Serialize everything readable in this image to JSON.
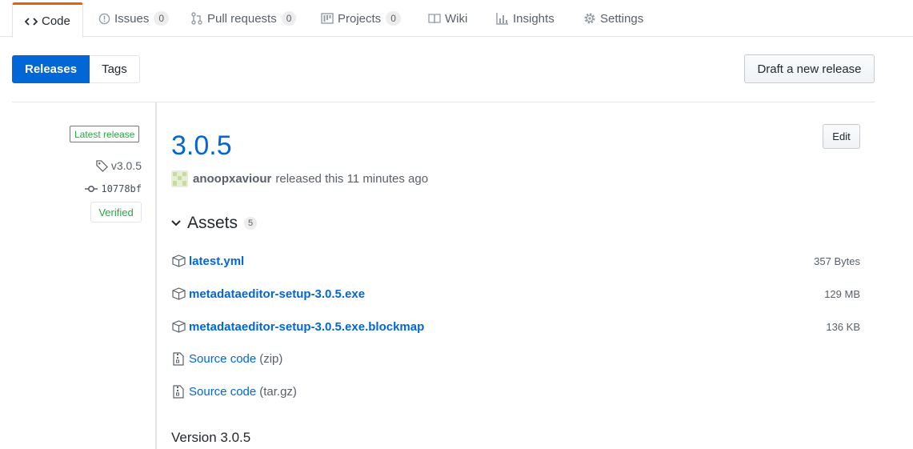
{
  "reponav": {
    "tabs": [
      {
        "label": "Code",
        "icon": "code-icon",
        "selected": true
      },
      {
        "label": "Issues",
        "icon": "issue-icon",
        "count": "0"
      },
      {
        "label": "Pull requests",
        "icon": "pull-request-icon",
        "count": "0"
      },
      {
        "label": "Projects",
        "icon": "project-icon",
        "count": "0"
      },
      {
        "label": "Wiki",
        "icon": "book-icon"
      },
      {
        "label": "Insights",
        "icon": "graph-icon"
      },
      {
        "label": "Settings",
        "icon": "gear-icon"
      }
    ]
  },
  "subnav": {
    "releases_label": "Releases",
    "tags_label": "Tags"
  },
  "draft_button_label": "Draft a new release",
  "release": {
    "latest_label": "Latest release",
    "tag": "v3.0.5",
    "commit": "10778bf",
    "verified_label": "Verified",
    "title": "3.0.5",
    "edit_label": "Edit",
    "author": "anoopxaviour",
    "released_text": "released this 11 minutes ago",
    "assets_label": "Assets",
    "assets_count": "5",
    "assets": [
      {
        "name": "latest.yml",
        "size": "357 Bytes",
        "icon": "package-icon"
      },
      {
        "name": "metadataeditor-setup-3.0.5.exe",
        "size": "129 MB",
        "icon": "package-icon"
      },
      {
        "name": "metadataeditor-setup-3.0.5.exe.blockmap",
        "size": "136 KB",
        "icon": "package-icon"
      },
      {
        "name": "Source code",
        "ext": "(zip)",
        "icon": "file-zip-icon"
      },
      {
        "name": "Source code",
        "ext": "(tar.gz)",
        "icon": "file-zip-icon"
      }
    ],
    "body_heading": "Version 3.0.5"
  },
  "colors": {
    "accent": "#0366d6",
    "tab_active_border": "#e36209",
    "success": "#28a745"
  }
}
